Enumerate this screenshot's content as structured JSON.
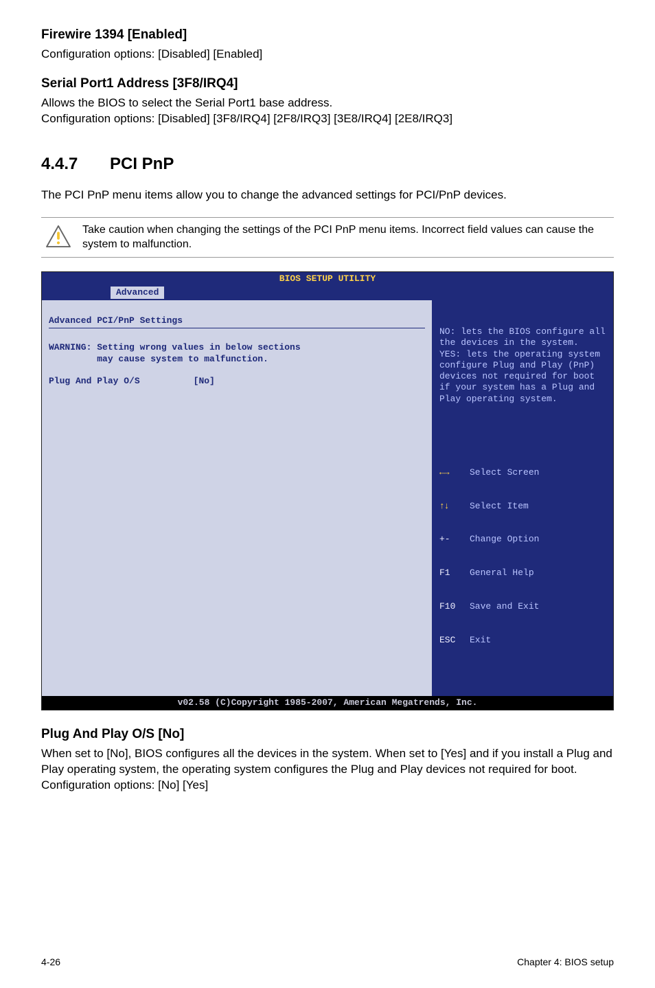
{
  "sections": {
    "firewire": {
      "heading": "Firewire 1394 [Enabled]",
      "text": "Configuration options: [Disabled] [Enabled]"
    },
    "serial": {
      "heading": "Serial Port1 Address [3F8/IRQ4]",
      "text": "Allows the BIOS to select the Serial Port1 base address.\nConfiguration options: [Disabled] [3F8/IRQ4] [2F8/IRQ3] [3E8/IRQ4] [2E8/IRQ3]"
    },
    "pcipnp": {
      "number": "4.4.7",
      "title": "PCI PnP",
      "intro": "The PCI PnP menu items allow you to change the advanced settings for PCI/PnP devices.",
      "caution": "Take caution when changing the settings of the PCI PnP menu items. Incorrect field values can cause the system to malfunction."
    },
    "plugplay": {
      "heading": "Plug And Play O/S [No]",
      "text": "When set to [No], BIOS configures all the devices in the system. When set to [Yes] and if you install a Plug and Play operating system, the operating system configures the Plug and Play devices not required for boot.\nConfiguration options: [No] [Yes]"
    }
  },
  "bios": {
    "title": "BIOS SETUP UTILITY",
    "tab": "Advanced",
    "panel_title": "Advanced PCI/PnP Settings",
    "warning_l1": "WARNING: Setting wrong values in below sections",
    "warning_l2": "         may cause system to malfunction.",
    "setting_label": "Plug And Play O/S",
    "setting_value": "[No]",
    "help": "NO: lets the BIOS configure all the devices in the system.\nYES: lets the operating system configure Plug and Play (PnP) devices not required for boot if your system has a Plug and Play operating system.",
    "legend": {
      "select_screen": "Select Screen",
      "select_item": "Select Item",
      "change_option_key": "+-",
      "change_option": "Change Option",
      "general_help_key": "F1",
      "general_help": "General Help",
      "save_exit_key": "F10",
      "save_exit": "Save and Exit",
      "exit_key": "ESC",
      "exit": "Exit"
    },
    "footer": "v02.58 (C)Copyright 1985-2007, American Megatrends, Inc."
  },
  "footer": {
    "page": "4-26",
    "chapter": "Chapter 4: BIOS setup"
  }
}
